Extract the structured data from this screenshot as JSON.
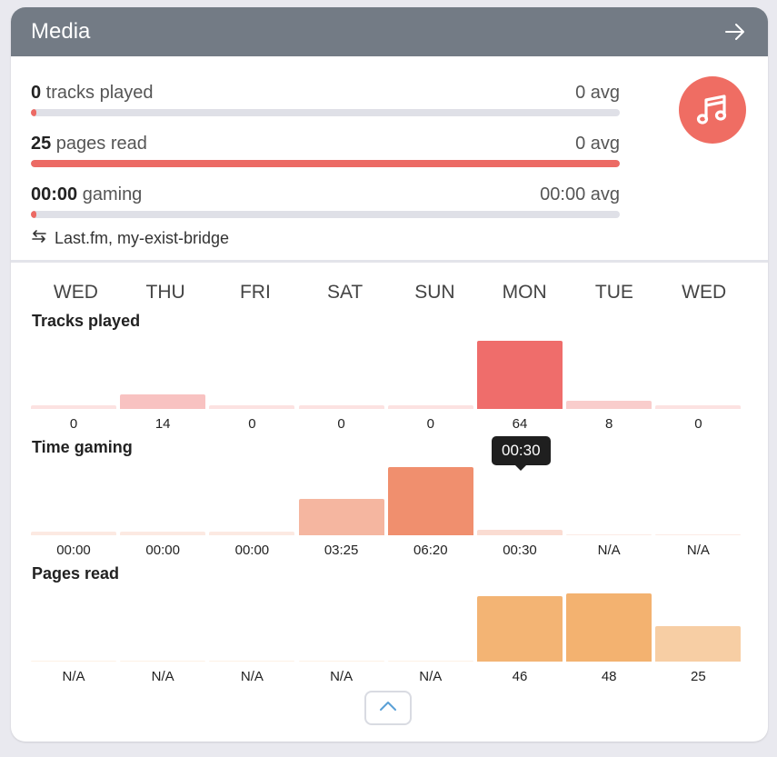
{
  "card": {
    "title": "Media",
    "header_icon": "arrow-right-icon",
    "badge_icon": "music-note-icon",
    "accent": "#ec6a64"
  },
  "summary": [
    {
      "value": "0",
      "label": " tracks played",
      "avg": "0 avg",
      "progress": 0.01
    },
    {
      "value": "25",
      "label": " pages read",
      "avg": "0 avg",
      "progress": 1.0
    },
    {
      "value": "00:00",
      "label": " gaming",
      "avg": "00:00 avg",
      "progress": 0.01
    }
  ],
  "sources": {
    "icon": "sync-arrows-icon",
    "text": "Last.fm, my-exist-bridge"
  },
  "days": [
    "WED",
    "THU",
    "FRI",
    "SAT",
    "SUN",
    "MON",
    "TUE",
    "WED"
  ],
  "sections": [
    {
      "title": "Tracks played",
      "color": "#ef6d6b",
      "values": [
        0,
        14,
        0,
        0,
        0,
        64,
        8,
        0
      ],
      "labels": [
        "0",
        "14",
        "0",
        "0",
        "0",
        "64",
        "8",
        "0"
      ],
      "max": 64
    },
    {
      "title": "Time gaming",
      "color": "#f08f6e",
      "values": [
        0,
        0,
        0,
        205,
        380,
        30,
        null,
        null
      ],
      "labels": [
        "00:00",
        "00:00",
        "00:00",
        "03:25",
        "06:20",
        "00:30",
        "N/A",
        "N/A"
      ],
      "max": 380
    },
    {
      "title": "Pages read",
      "color": "#f3b270",
      "values": [
        null,
        null,
        null,
        null,
        null,
        46,
        48,
        25
      ],
      "labels": [
        "N/A",
        "N/A",
        "N/A",
        "N/A",
        "N/A",
        "46",
        "48",
        "25"
      ],
      "max": 48
    }
  ],
  "tooltip": {
    "text": "00:30"
  },
  "collapse_icon": "chevron-up-icon"
}
